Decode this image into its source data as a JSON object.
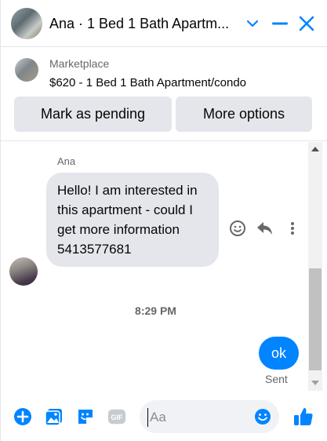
{
  "header": {
    "title": "Ana · 1 Bed 1 Bath Apartm...",
    "icons": [
      "chevron-down-icon",
      "minimize-icon",
      "close-icon"
    ]
  },
  "marketplace": {
    "label": "Marketplace",
    "listing": "$620 - 1 Bed 1 Bath Apartment/condo",
    "buttons": {
      "pending": "Mark as pending",
      "more": "More options"
    }
  },
  "conversation": {
    "sender": "Ana",
    "incoming_message": "Hello! I am interested in this apartment - could I get more information 5413577681",
    "timestamp": "8:29 PM",
    "outgoing_message": "ok",
    "status": "Sent"
  },
  "composer": {
    "placeholder": "Aa",
    "icons": [
      "plus-icon",
      "photo-icon",
      "sticker-icon",
      "gif-icon",
      "emoji-icon",
      "like-icon"
    ]
  },
  "colors": {
    "accent": "#0084ff",
    "bubble_in": "#e4e6eb",
    "muted": "#65676b"
  }
}
